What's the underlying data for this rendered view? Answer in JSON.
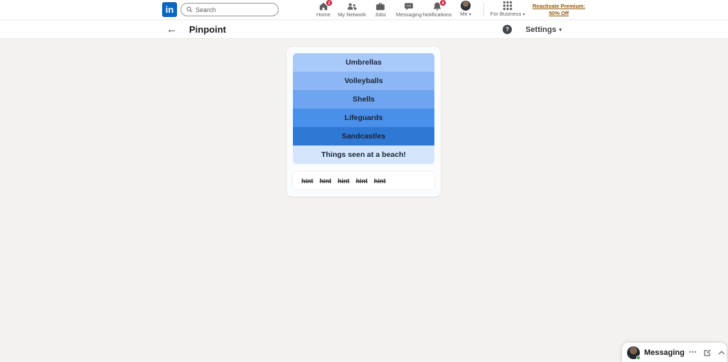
{
  "topnav": {
    "logo_text": "in",
    "search_placeholder": "Search",
    "items": [
      {
        "label": "Home",
        "badge": "2"
      },
      {
        "label": "My Network",
        "badge": ""
      },
      {
        "label": "Jobs",
        "badge": ""
      },
      {
        "label": "Messaging",
        "badge": ""
      },
      {
        "label": "Notifications",
        "badge": "8"
      },
      {
        "label": "Me",
        "badge": ""
      }
    ],
    "for_business_label": "For Business",
    "premium_line1": "Reactivate Premium:",
    "premium_line2": "50% Off"
  },
  "subheader": {
    "title": "Pinpoint",
    "settings_label": "Settings"
  },
  "icons": {
    "back": "←",
    "help": "?",
    "chevron_down": "▾",
    "more": "⋯"
  },
  "game": {
    "bars": [
      {
        "label": "Umbrellas",
        "color": "#a8c9fa"
      },
      {
        "label": "Volleyballs",
        "color": "#8cb6f4"
      },
      {
        "label": "Shells",
        "color": "#6ea4f0"
      },
      {
        "label": "Lifeguards",
        "color": "#4a90ea"
      },
      {
        "label": "Sandcastles",
        "color": "#2f78d4"
      },
      {
        "label": "Things seen at a beach!",
        "color": "#d5e5fc"
      }
    ],
    "hints": [
      "hint",
      "hint",
      "hint",
      "hint",
      "hint"
    ]
  },
  "messaging_dock": {
    "label": "Messaging"
  },
  "colors": {
    "linkedin_blue": "#0a66c2",
    "premium_gold": "#915907",
    "badge_red": "#cb112d",
    "presence_green": "#31a24c",
    "page_background": "#f4f2ee"
  }
}
